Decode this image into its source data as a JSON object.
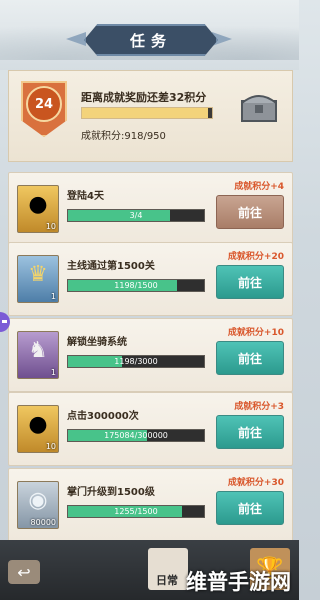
{
  "title": "任务",
  "achievement": {
    "level": "24",
    "headline": "距离成就奖励还差32积分",
    "score_label": "成就积分:918/950",
    "progress": 0.966
  },
  "tasks": [
    {
      "name": "登陆4天",
      "progress_text": "3/4",
      "progress": 0.75,
      "reward": "成就积分+4",
      "button": "前往",
      "icon": "gold-ingot-icon",
      "icon_count": "10",
      "button_state": "dim"
    },
    {
      "name": "主线通过第1500关",
      "progress_text": "1198/1500",
      "progress": 0.798,
      "reward": "成就积分+20",
      "button": "前往",
      "icon": "crown-badge-icon",
      "icon_count": "1",
      "button_state": "active"
    },
    {
      "name": "解锁坐骑系统",
      "progress_text": "1198/3000",
      "progress": 0.399,
      "reward": "成就积分+10",
      "button": "前往",
      "icon": "horse-icon",
      "icon_count": "1",
      "button_state": "active"
    },
    {
      "name": "点击300000次",
      "progress_text": "175084/300000",
      "progress": 0.583,
      "reward": "成就积分+3",
      "button": "前往",
      "icon": "gold-ingot-icon",
      "icon_count": "10",
      "button_state": "active"
    },
    {
      "name": "掌门升级到1500级",
      "progress_text": "1255/1500",
      "progress": 0.837,
      "reward": "成就积分+30",
      "button": "前往",
      "icon": "silver-coin-icon",
      "icon_count": "80000",
      "button_state": "active"
    }
  ],
  "bottom_nav": {
    "back_icon": "back-arrow-icon",
    "daily_label": "日常",
    "trophy_icon": "trophy-icon"
  },
  "watermark": "维普手游网"
}
